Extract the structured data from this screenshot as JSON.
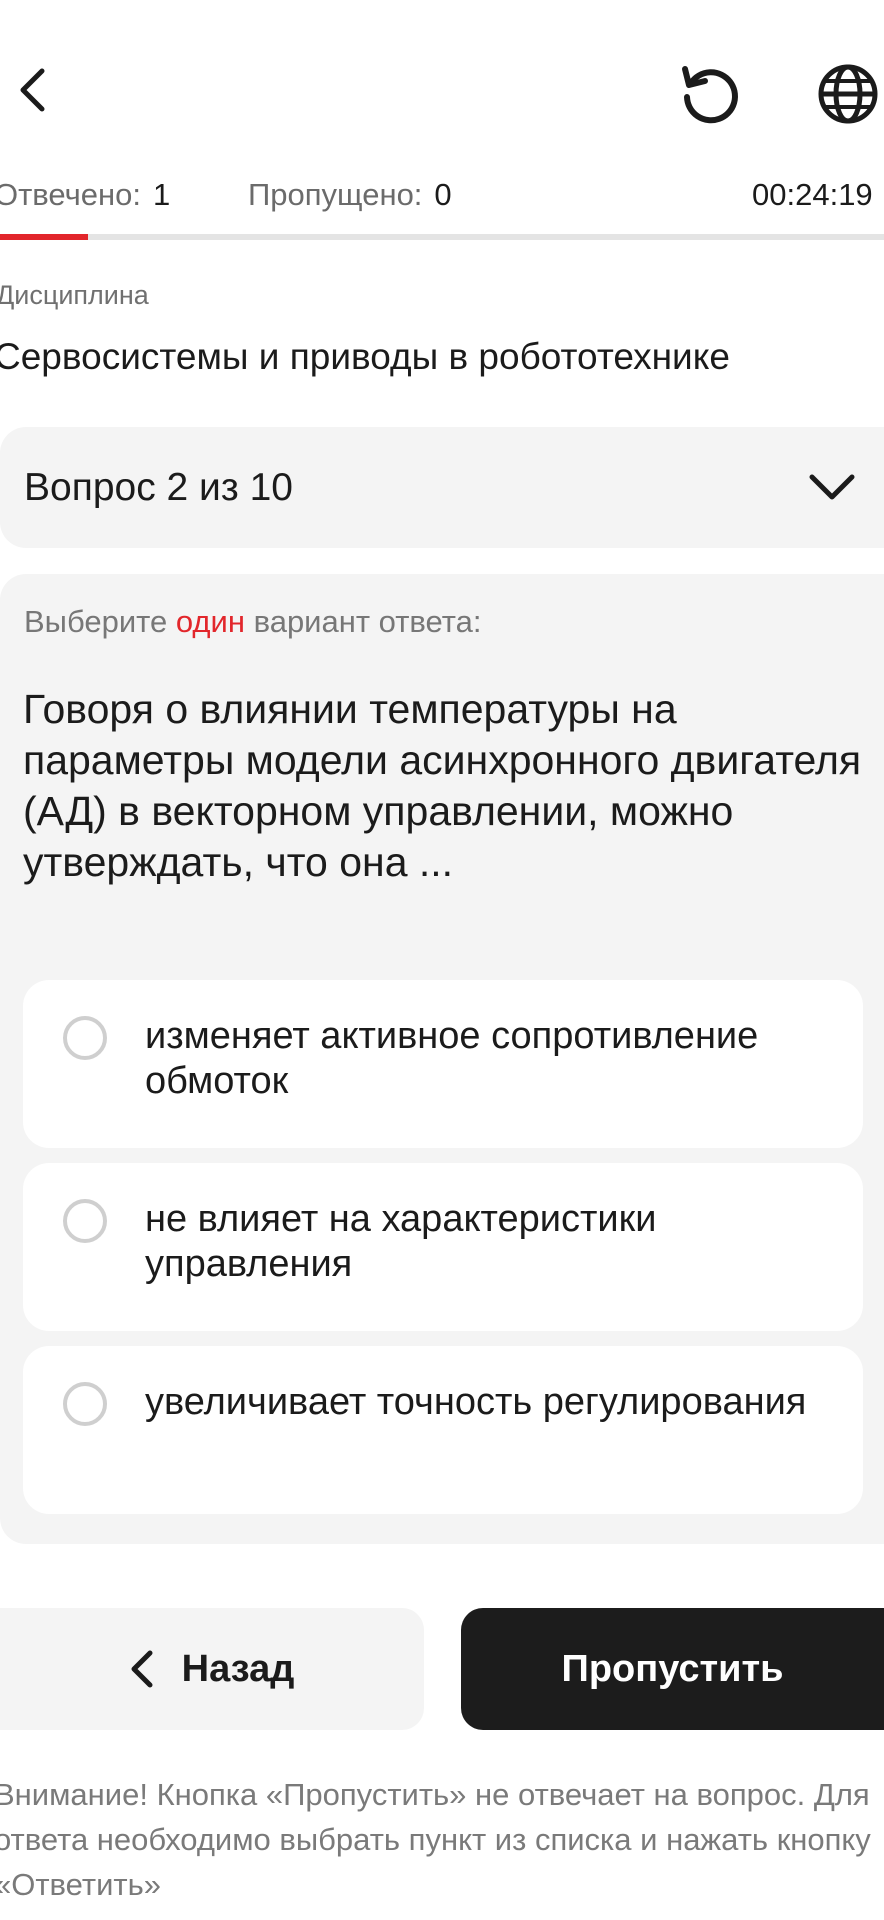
{
  "header": {
    "back_icon": "chevron-left-icon",
    "reset_icon": "restart-icon",
    "language_icon": "globe-icon"
  },
  "counters": {
    "answered_label": "Отвечено:",
    "answered_value": "1",
    "skipped_label": "Пропущено:",
    "skipped_value": "0",
    "timer": "00:24:19"
  },
  "progress": {
    "fraction": 0.1,
    "color": "#e2262b"
  },
  "discipline": {
    "label": "Дисциплина",
    "title": "Сервосистемы и приводы в робототехнике"
  },
  "question_selector": {
    "label": "Вопрос 2 из 10"
  },
  "question": {
    "instruction_before": "Выберите ",
    "instruction_accent": "один",
    "instruction_after": " вариант ответа:",
    "text": "Говоря о влиянии температуры на параметры модели асинхронного двигателя (АД) в векторном управлении, можно утверждать, что она ...",
    "options": [
      {
        "text": "изменяет активное сопротивление обмоток",
        "selected": false
      },
      {
        "text": "не влияет на характеристики управления",
        "selected": false
      },
      {
        "text": "увеличивает точность регулирования",
        "selected": false
      }
    ]
  },
  "buttons": {
    "back_label": "Назад",
    "skip_label": "Пропустить"
  },
  "notice": "Внимание! Кнопка «Пропустить» не отвечает на вопрос. Для ответа необходимо выбрать пункт из списка и нажать кнопку «Ответить»",
  "colors": {
    "accent": "#e2262b",
    "dark_button": "#1c1c1c",
    "card_bg": "#f4f4f4"
  }
}
